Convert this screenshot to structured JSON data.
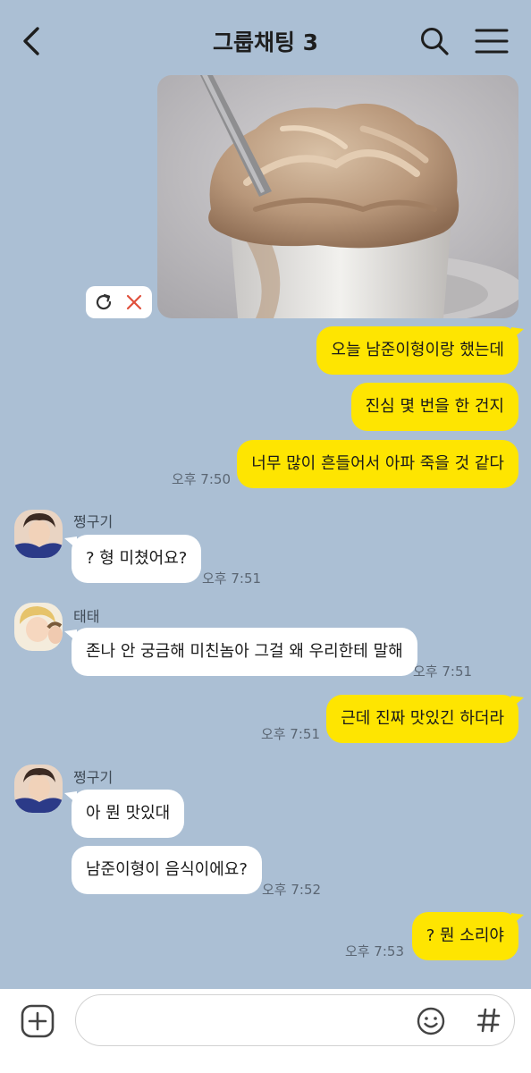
{
  "header": {
    "title": "그룹채팅 3"
  },
  "photo_actions": {
    "retry_icon": "refresh-icon",
    "delete_icon": "close-icon"
  },
  "messages": [
    {
      "text": "오늘 남준이형이랑 했는데"
    },
    {
      "text": "진심 몇 번을 한 건지"
    },
    {
      "text": "너무 많이 흔들어서 아파 죽을 것 같다",
      "time": "오후 7:50"
    },
    {
      "sender": "쩡구기",
      "text": "? 형 미쳤어요?",
      "time": "오후 7:51"
    },
    {
      "sender": "태태",
      "text": "존나 안 궁금해 미친놈아 그걸 왜 우리한테 말해",
      "time": "오후 7:51"
    },
    {
      "text": "근데 진짜 맛있긴 하더라",
      "time": "오후 7:51"
    },
    {
      "sender": "쩡구기",
      "text": "아 뭔 맛있대"
    },
    {
      "text": "남준이형이 음식이에요?",
      "time": "오후 7:52"
    },
    {
      "text": "? 뭔 소리야",
      "time": "오후 7:53"
    }
  ],
  "input": {
    "value": ""
  },
  "colors": {
    "background": "#abbfd4",
    "my_bubble": "#fee501",
    "their_bubble": "#ffffff",
    "delete_icon": "#e0503c"
  }
}
